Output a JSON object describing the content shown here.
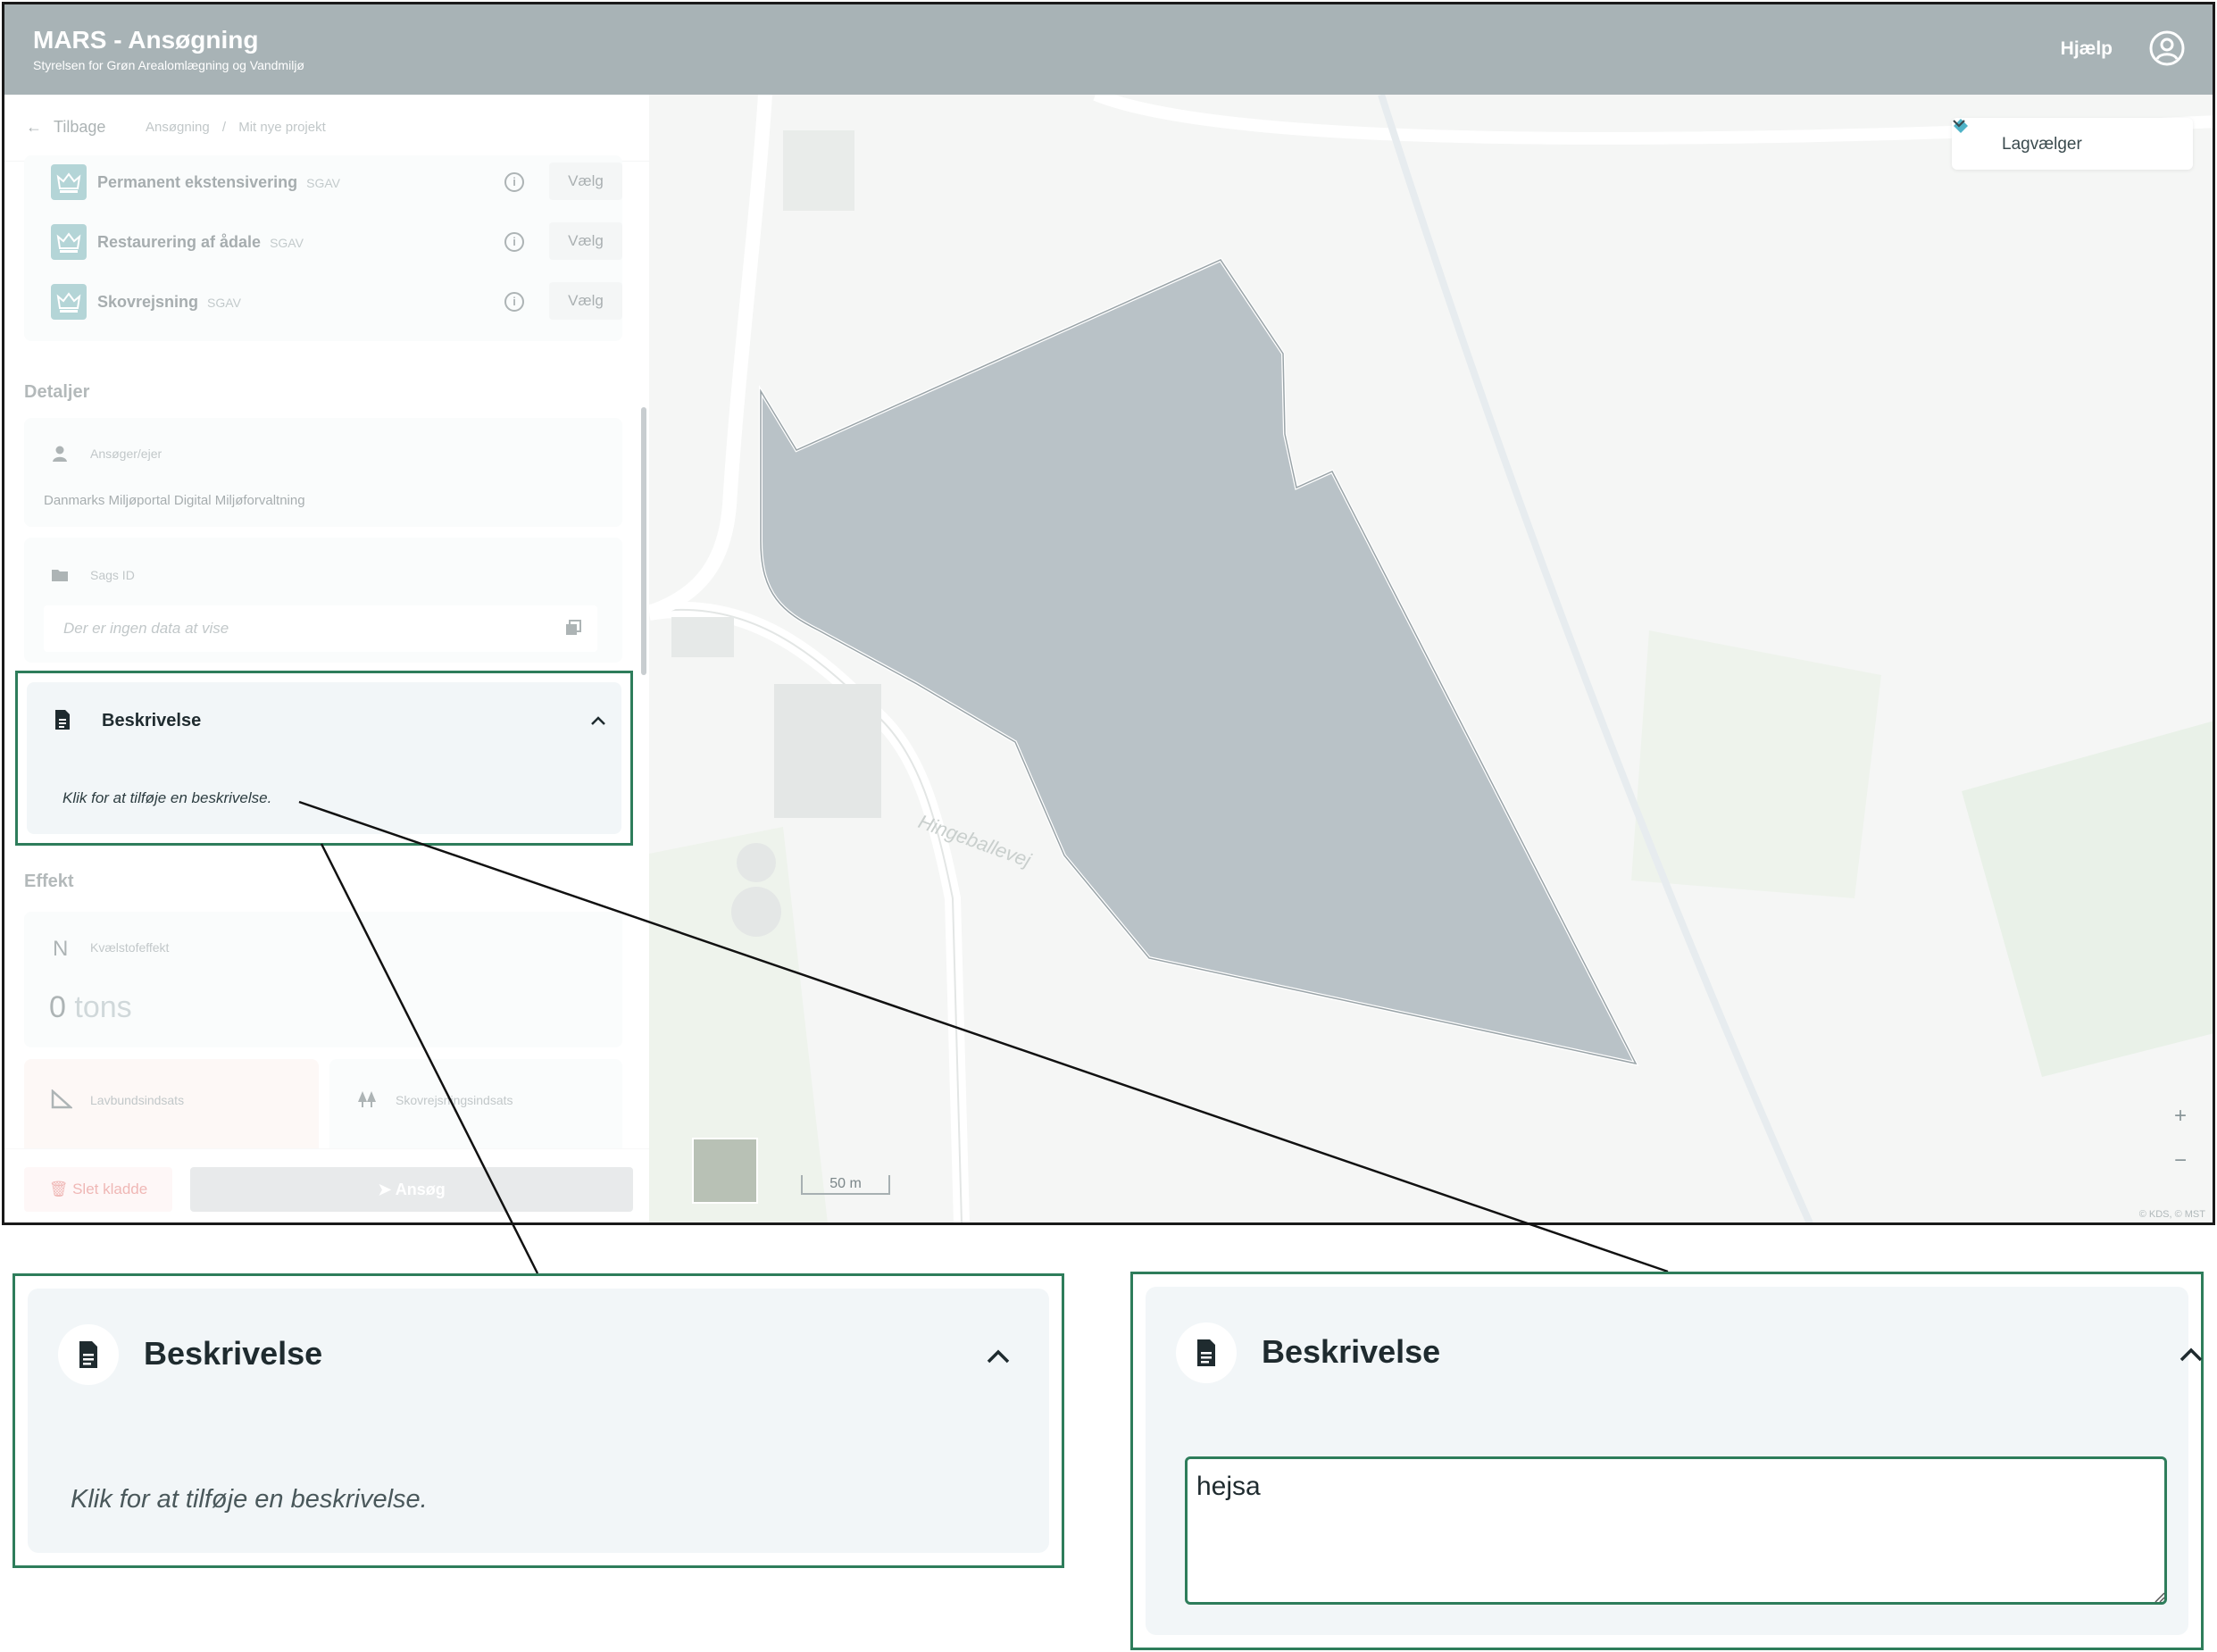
{
  "app": {
    "title": "MARS - Ansøgning",
    "subtitle": "Styrelsen for Grøn Arealomlægning og Vandmiljø",
    "help_label": "Hjælp",
    "user_icon": "user-circle-icon"
  },
  "nav": {
    "back_label": "Tilbage",
    "breadcrumb": [
      "Ansøgning",
      "Mit nye projekt"
    ],
    "separator": "/"
  },
  "measures": [
    {
      "name": "Permanent ekstensivering",
      "source": "SGAV",
      "choose_label": "Vælg"
    },
    {
      "name": "Restaurering af ådale",
      "source": "SGAV",
      "choose_label": "Vælg"
    },
    {
      "name": "Skovrejsning",
      "source": "SGAV",
      "choose_label": "Vælg"
    }
  ],
  "details": {
    "heading": "Detaljer",
    "applicant_label": "Ansøger/ejer",
    "applicant_value": "Danmarks Miljøportal Digital Miljøforvaltning",
    "case_label": "Sags ID",
    "case_empty": "Der er ingen data at vise"
  },
  "description": {
    "heading": "Beskrivelse",
    "hint": "Klik for at tilføje en beskrivelse.",
    "typed_value": "hejsa"
  },
  "effect": {
    "heading": "Effekt",
    "nitrogen_symbol": "N",
    "nitrogen_label": "Kvælstofeffekt",
    "nitrogen_value": "0",
    "nitrogen_unit": "tons",
    "lowland_label": "Lavbundsindsats",
    "forest_label": "Skovrejsningsindsats"
  },
  "footer": {
    "delete_label": "Slet kladde",
    "apply_label": "Ansøg"
  },
  "map": {
    "layer_picker_label": "Lagvælger",
    "road_label": "Hingeballevej",
    "scale_label": "50 m",
    "zoom_in": "+",
    "zoom_out": "−",
    "attribution": "© KDS, © MST"
  },
  "colors": {
    "header_bg": "#a8b3b6",
    "accent_green": "#2e7d5b",
    "polygon_fill": "#b9c2c7",
    "panel_card": "#f2f6f8"
  }
}
